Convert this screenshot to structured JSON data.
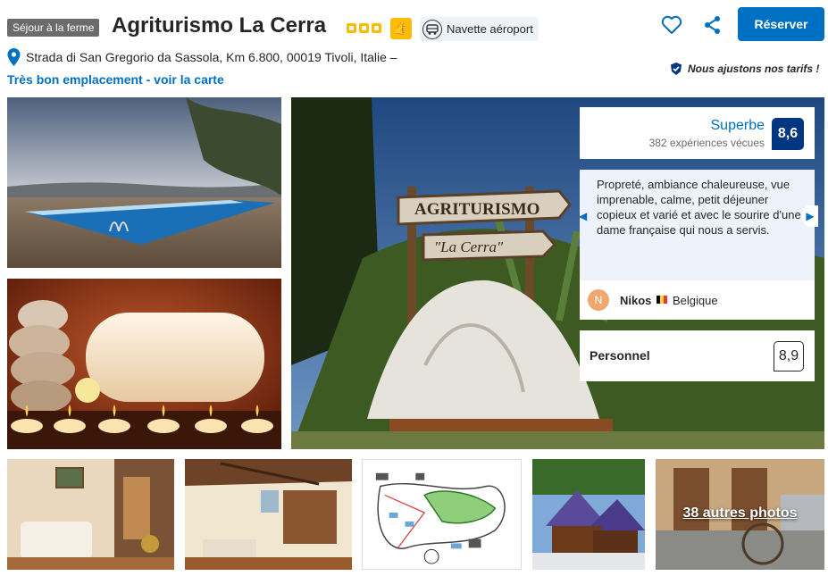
{
  "header": {
    "type_badge": "Séjour à la ferme",
    "title": "Agriturismo La Cerra",
    "star_count": 3,
    "shuttle_label": "Navette aéroport",
    "reserve_label": "Réserver",
    "address": "Strada di San Gregorio da Sassola, Km 6.800, 00019 Tivoli, Italie –",
    "location_link": "Très bon emplacement - voir la carte",
    "price_note": "Nous ajustons nos tarifs !"
  },
  "gallery": {
    "main_sign_line1": "AGRITURISMO",
    "main_sign_line2": "\"La Cerra\"",
    "more_photos": "38 autres photos"
  },
  "rating": {
    "word": "Superbe",
    "count": "382 expériences vécues",
    "score": "8,6"
  },
  "review": {
    "text": "Propreté, ambiance chaleureuse, vue imprenable, calme, petit déjeuner copieux et varié et avec le sourire d'une dame française qui nous a servis.",
    "avatar_initial": "N",
    "reviewer": "Nikos",
    "country": "Belgique",
    "flag_colors": [
      "#000000",
      "#fdda24",
      "#ef3340"
    ]
  },
  "staff": {
    "label": "Personnel",
    "score": "8,9"
  },
  "colors": {
    "brand_blue": "#0071c2",
    "score_dark_blue": "#003580",
    "star_yellow": "#febb02"
  }
}
